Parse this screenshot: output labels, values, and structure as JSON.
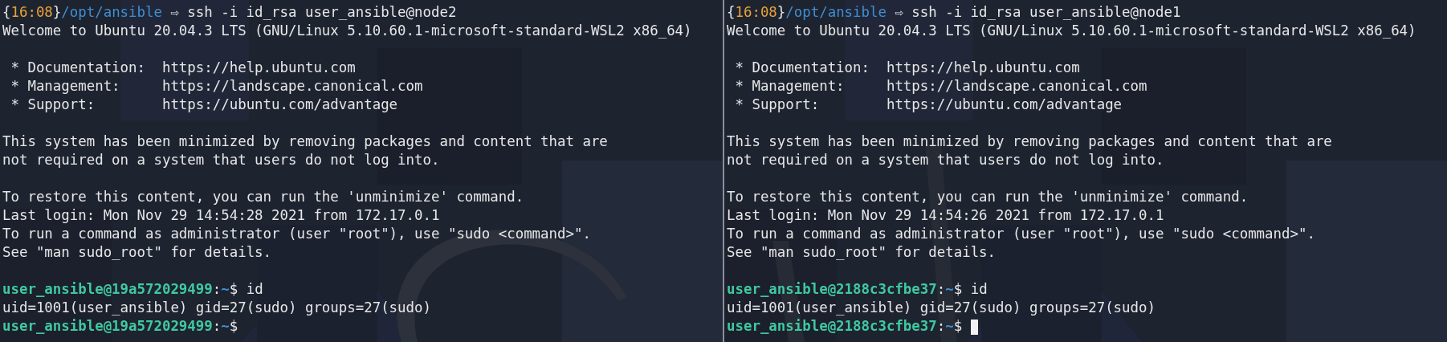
{
  "panes": [
    {
      "lines": [
        {
          "kind": "zsh",
          "open_brace": "{",
          "time": "16:08",
          "close_brace": "}",
          "path": "/opt/ansible",
          "arrow": "⇨",
          "command": "ssh -i id_rsa user_ansible@node2"
        },
        {
          "kind": "text",
          "text": "Welcome to Ubuntu 20.04.3 LTS (GNU/Linux 5.10.60.1-microsoft-standard-WSL2 x86_64)"
        },
        {
          "kind": "blank"
        },
        {
          "kind": "text",
          "text": " * Documentation:  https://help.ubuntu.com"
        },
        {
          "kind": "text",
          "text": " * Management:     https://landscape.canonical.com"
        },
        {
          "kind": "text",
          "text": " * Support:        https://ubuntu.com/advantage"
        },
        {
          "kind": "blank"
        },
        {
          "kind": "text",
          "text": "This system has been minimized by removing packages and content that are"
        },
        {
          "kind": "text",
          "text": "not required on a system that users do not log into."
        },
        {
          "kind": "blank"
        },
        {
          "kind": "text",
          "text": "To restore this content, you can run the 'unminimize' command."
        },
        {
          "kind": "text",
          "text": "Last login: Mon Nov 29 14:54:28 2021 from 172.17.0.1"
        },
        {
          "kind": "text",
          "text": "To run a command as administrator (user \"root\"), use \"sudo <command>\"."
        },
        {
          "kind": "text",
          "text": "See \"man sudo_root\" for details."
        },
        {
          "kind": "blank"
        },
        {
          "kind": "shell",
          "user_host": "user_ansible@19a572029499",
          "separator": ":",
          "dir": "~",
          "sigil": "$",
          "command": "id",
          "cursor": false
        },
        {
          "kind": "text",
          "text": "uid=1001(user_ansible) gid=27(sudo) groups=27(sudo)"
        },
        {
          "kind": "shell",
          "user_host": "user_ansible@19a572029499",
          "separator": ":",
          "dir": "~",
          "sigil": "$",
          "cursor": false
        }
      ]
    },
    {
      "lines": [
        {
          "kind": "zsh",
          "open_brace": "{",
          "time": "16:08",
          "close_brace": "}",
          "path": "/opt/ansible",
          "arrow": "⇨",
          "command": "ssh -i id_rsa user_ansible@node1"
        },
        {
          "kind": "text",
          "text": "Welcome to Ubuntu 20.04.3 LTS (GNU/Linux 5.10.60.1-microsoft-standard-WSL2 x86_64)"
        },
        {
          "kind": "blank"
        },
        {
          "kind": "text",
          "text": " * Documentation:  https://help.ubuntu.com"
        },
        {
          "kind": "text",
          "text": " * Management:     https://landscape.canonical.com"
        },
        {
          "kind": "text",
          "text": " * Support:        https://ubuntu.com/advantage"
        },
        {
          "kind": "blank"
        },
        {
          "kind": "text",
          "text": "This system has been minimized by removing packages and content that are"
        },
        {
          "kind": "text",
          "text": "not required on a system that users do not log into."
        },
        {
          "kind": "blank"
        },
        {
          "kind": "text",
          "text": "To restore this content, you can run the 'unminimize' command."
        },
        {
          "kind": "text",
          "text": "Last login: Mon Nov 29 14:54:26 2021 from 172.17.0.1"
        },
        {
          "kind": "text",
          "text": "To run a command as administrator (user \"root\"), use \"sudo <command>\"."
        },
        {
          "kind": "text",
          "text": "See \"man sudo_root\" for details."
        },
        {
          "kind": "blank"
        },
        {
          "kind": "shell",
          "user_host": "user_ansible@2188c3cfbe37",
          "separator": ":",
          "dir": "~",
          "sigil": "$",
          "command": "id",
          "cursor": false
        },
        {
          "kind": "text",
          "text": "uid=1001(user_ansible) gid=27(sudo) groups=27(sudo)"
        },
        {
          "kind": "shell",
          "user_host": "user_ansible@2188c3cfbe37",
          "separator": ":",
          "dir": "~",
          "sigil": "$",
          "cursor": true
        }
      ]
    }
  ]
}
